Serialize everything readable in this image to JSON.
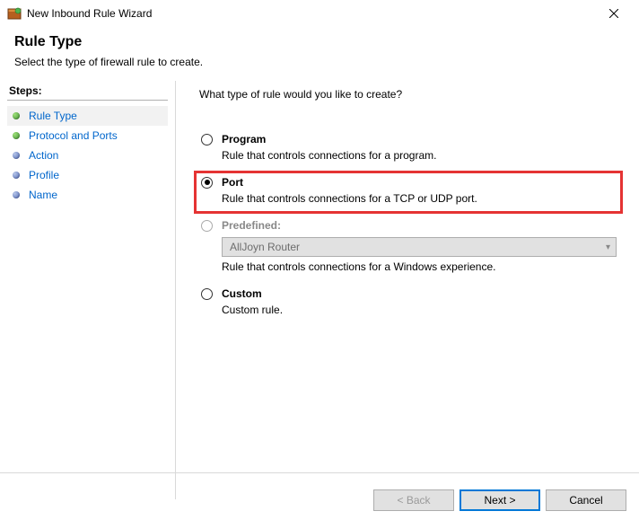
{
  "titlebar": {
    "title": "New Inbound Rule Wizard"
  },
  "header": {
    "title": "Rule Type",
    "subtitle": "Select the type of firewall rule to create."
  },
  "sidebar": {
    "heading": "Steps:",
    "items": [
      {
        "label": "Rule Type"
      },
      {
        "label": "Protocol and Ports"
      },
      {
        "label": "Action"
      },
      {
        "label": "Profile"
      },
      {
        "label": "Name"
      }
    ]
  },
  "content": {
    "prompt": "What type of rule would you like to create?",
    "options": {
      "program": {
        "label": "Program",
        "desc": "Rule that controls connections for a program."
      },
      "port": {
        "label": "Port",
        "desc": "Rule that controls connections for a TCP or UDP port."
      },
      "predefined": {
        "label": "Predefined:",
        "selected": "AllJoyn Router",
        "desc": "Rule that controls connections for a Windows experience."
      },
      "custom": {
        "label": "Custom",
        "desc": "Custom rule."
      }
    }
  },
  "footer": {
    "back": "< Back",
    "next": "Next >",
    "cancel": "Cancel"
  }
}
